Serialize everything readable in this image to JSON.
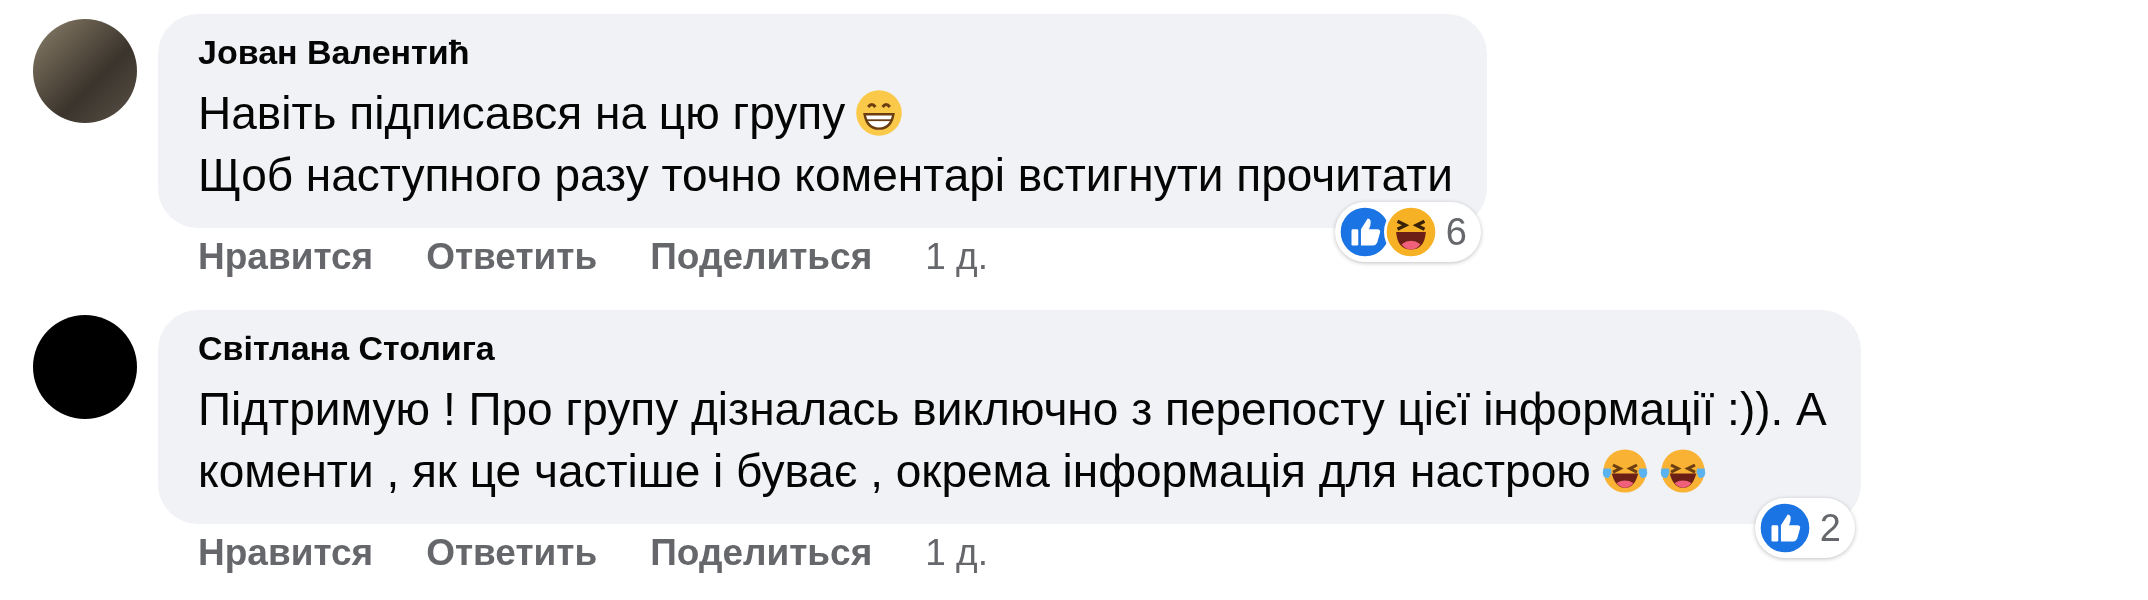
{
  "comments": [
    {
      "author": "Јован Валентић",
      "avatar": {
        "kind": "photo"
      },
      "lines": [
        {
          "text": "Навіть підписався на цю групу",
          "emoji": [
            {
              "kind": "grin"
            }
          ]
        },
        {
          "text": "Щоб наступного разу точно коментарі встигнути прочитати"
        }
      ],
      "reactions": [
        {
          "kind": "like"
        },
        {
          "kind": "haha"
        }
      ],
      "reaction_count": "6",
      "actions": [
        "Нравится",
        "Ответить",
        "Поделиться"
      ],
      "time": "1 д."
    },
    {
      "author": "Світлана Столига",
      "avatar": {
        "kind": "dark"
      },
      "lines": [
        {
          "text": "Підтримую ! Про групу дізналась виключно з перепосту цієї інформації :)). А"
        },
        {
          "text": "коменти , як це частіше і буває , окрема інформація для настрою",
          "emoji": [
            {
              "kind": "tears"
            },
            {
              "kind": "tears"
            }
          ]
        }
      ],
      "reactions": [
        {
          "kind": "like"
        }
      ],
      "reaction_count": "2",
      "actions": [
        "Нравится",
        "Ответить",
        "Поделиться"
      ],
      "time": "1 д."
    }
  ]
}
